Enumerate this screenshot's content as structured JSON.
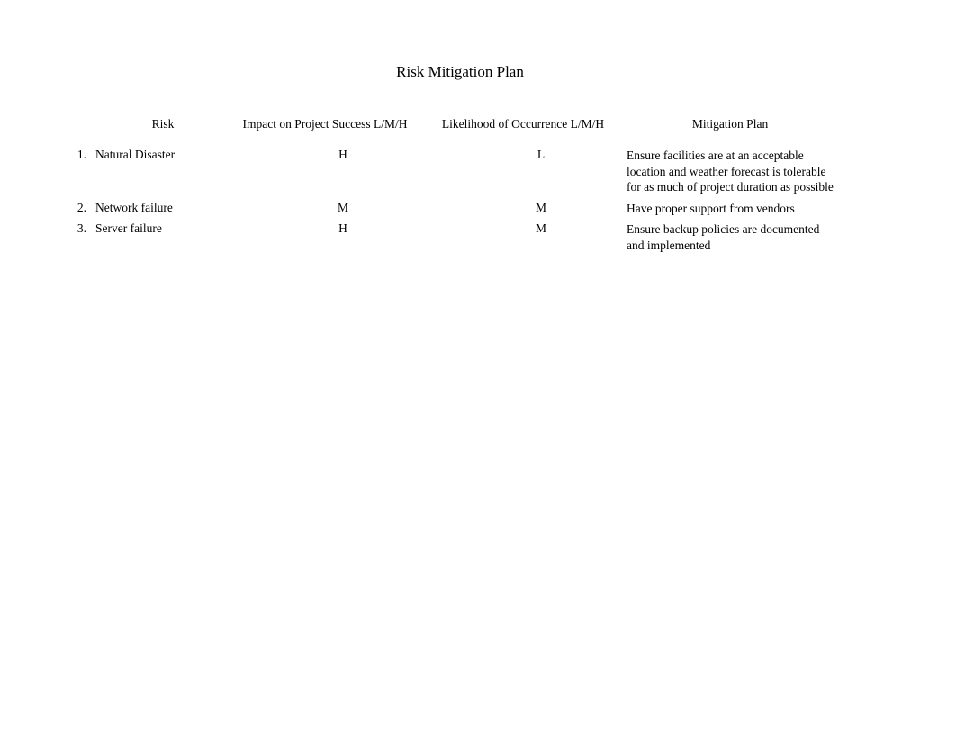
{
  "title": "Risk Mitigation Plan",
  "headers": {
    "risk": "Risk",
    "impact": "Impact on Project Success L/M/H",
    "likelihood": "Likelihood of Occurrence L/M/H",
    "mitigation": "Mitigation Plan"
  },
  "rows": [
    {
      "num": "1.",
      "risk": "Natural Disaster",
      "impact": "H",
      "likelihood": "L",
      "mitigation": "Ensure facilities are at an acceptable location and weather forecast is tolerable for as much of project duration as possible"
    },
    {
      "num": "2.",
      "risk": "Network failure",
      "impact": "M",
      "likelihood": "M",
      "mitigation": "Have proper support from vendors"
    },
    {
      "num": "3.",
      "risk": "Server failure",
      "impact": "H",
      "likelihood": "M",
      "mitigation": "Ensure backup policies are documented and implemented"
    }
  ]
}
